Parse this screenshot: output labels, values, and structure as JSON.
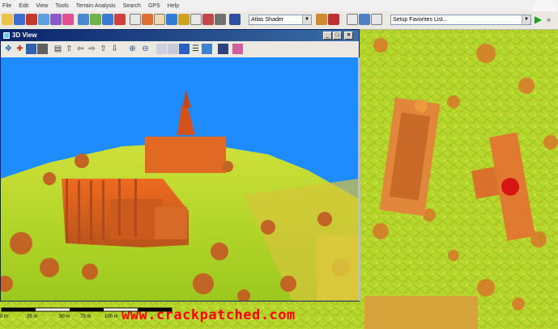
{
  "menu": {
    "items": [
      "File",
      "Edit",
      "View",
      "Tools",
      "Terrain Analysis",
      "Search",
      "GPS",
      "Help"
    ]
  },
  "toolbar": {
    "shader_select": "Atlas Shader",
    "favorites_select": "Setup Favorites List..."
  },
  "window_3d": {
    "title": "3D View",
    "minimize": "_",
    "maximize": "□",
    "close": "×"
  },
  "scale": {
    "labels": [
      "0 m",
      "25 m",
      "50 m",
      "75 m",
      "100 m"
    ]
  },
  "watermark": "www.crackpatched.com",
  "colors": {
    "sky": "#1e8bff",
    "terrain_low": "#b8dc2a",
    "terrain_mid": "#e0d040",
    "terrain_high": "#d85020",
    "title_bar": "#0a246a",
    "watermark": "#ff0000"
  }
}
